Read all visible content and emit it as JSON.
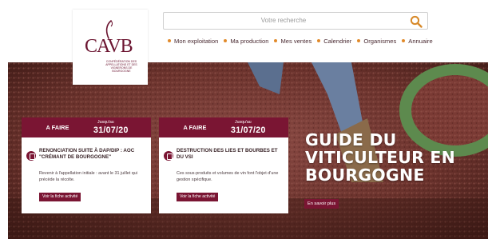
{
  "logo": {
    "text": "CAVB",
    "tagline": "CONFÉDÉRATION DES APPELLATIONS ET DES VIGNERONS DE BOURGOGNE"
  },
  "search": {
    "placeholder": "Votre recherche"
  },
  "nav": {
    "items": [
      {
        "label": "Mon exploitation"
      },
      {
        "label": "Ma production"
      },
      {
        "label": "Mes ventes"
      },
      {
        "label": "Calendrier"
      },
      {
        "label": "Organismes"
      },
      {
        "label": "Annuaire"
      }
    ]
  },
  "cards": [
    {
      "heading": "A FAIRE",
      "until": "Jusqu'au",
      "date": "31/07/20",
      "title": "RENONCIATION SUITE À DAP/DIP : AOC \"CRÉMANT DE BOURGOGNE\"",
      "description": "Revenir à l'appellation initiale : avant le 31 juillet qui précède la récolte.",
      "button": "Voir la fiche activité"
    },
    {
      "heading": "A FAIRE",
      "until": "Jusqu'au",
      "date": "31/07/20",
      "title": "DESTRUCTION DES LIES ET BOURBES ET DU VSI",
      "description": "Ces sous-produits et volumes de vin font l'objet d'une gestion spécifique.",
      "button": "Voir la fiche activité"
    }
  ],
  "hero": {
    "title": "GUIDE DU VITICULTEUR EN BOURGOGNE",
    "button": "En savoir plus"
  },
  "colors": {
    "brand": "#7a1533",
    "accent_dot": "#e18a2a",
    "search_icon": "#d88a2a"
  }
}
